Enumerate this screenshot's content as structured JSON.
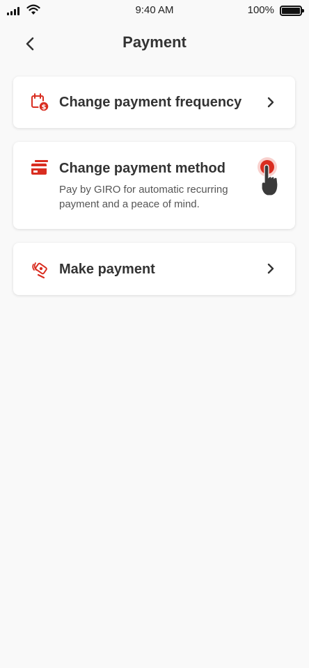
{
  "status_bar": {
    "time": "9:40 AM",
    "battery": "100%"
  },
  "header": {
    "title": "Payment",
    "back_icon": "chevron-left-icon"
  },
  "menu": [
    {
      "icon": "calendar-dollar-icon",
      "title": "Change payment frequency",
      "description": "",
      "trailing": "chevron-right-icon"
    },
    {
      "icon": "card-icon",
      "title": "Change payment method",
      "description": "Pay by GIRO for automatic recurring payment and a peace of mind.",
      "trailing": "tap-indicator"
    },
    {
      "icon": "hand-payment-icon",
      "title": "Make payment",
      "description": "",
      "trailing": "chevron-right-icon"
    }
  ],
  "colors": {
    "accent": "#d92d20",
    "background": "#f9f9f9",
    "card": "#ffffff",
    "text": "#333333"
  }
}
